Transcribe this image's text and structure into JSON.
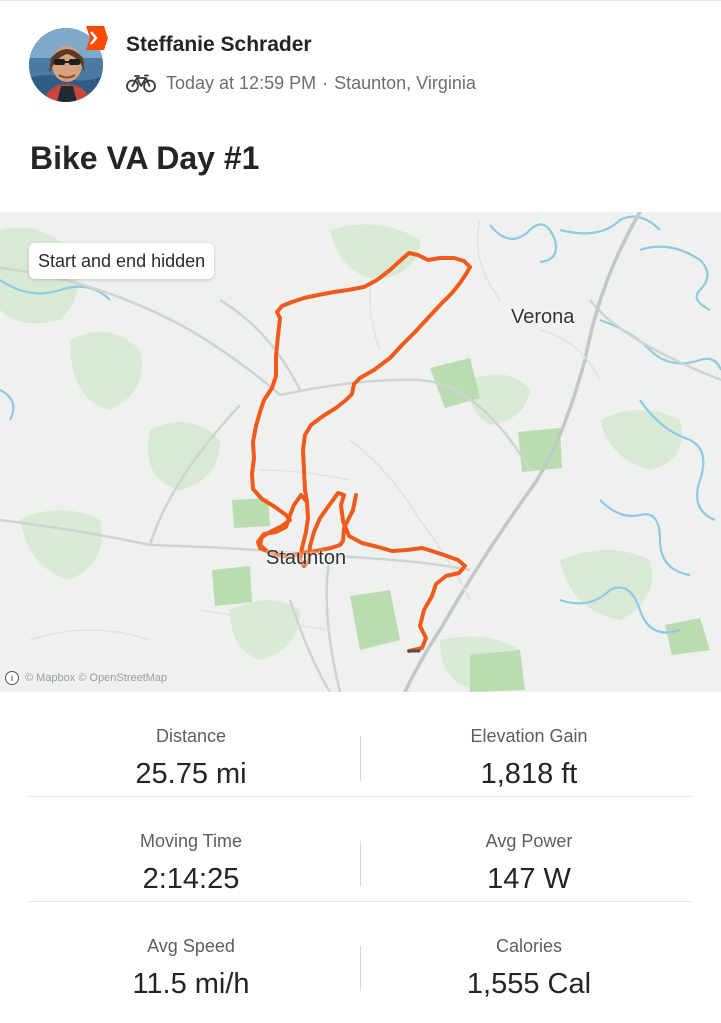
{
  "header": {
    "athlete_name": "Steffanie Schrader",
    "sport_icon": "bike-icon",
    "timestamp": "Today at 12:59 PM",
    "separator": "·",
    "location": "Staunton, Virginia"
  },
  "activity": {
    "title": "Bike VA Day #1"
  },
  "map": {
    "privacy_chip": "Start and end hidden",
    "place_labels": [
      "Verona",
      "Staunton"
    ],
    "attribution": "© Mapbox © OpenStreetMap",
    "route_color": "#f05a1c"
  },
  "stats": [
    {
      "label": "Distance",
      "value": "25.75 mi"
    },
    {
      "label": "Elevation Gain",
      "value": "1,818 ft"
    },
    {
      "label": "Moving Time",
      "value": "2:14:25"
    },
    {
      "label": "Avg Power",
      "value": "147 W"
    },
    {
      "label": "Avg Speed",
      "value": "11.5 mi/h"
    },
    {
      "label": "Calories",
      "value": "1,555 Cal"
    }
  ],
  "colors": {
    "brand": "#fc4c02",
    "text_primary": "#242428",
    "text_secondary": "#6d6d78"
  }
}
